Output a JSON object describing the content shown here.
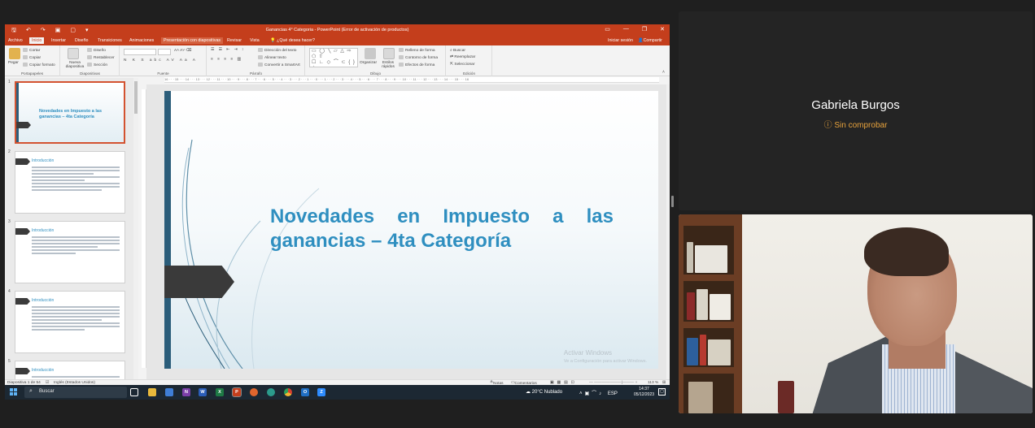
{
  "powerpoint": {
    "window_title": "Ganancias 4° Categoria - PowerPoint (Error de activación de productos)",
    "tabs": [
      "Archivo",
      "Inicio",
      "Insertar",
      "Diseño",
      "Transiciones",
      "Animaciones",
      "Presentación con diapositivas",
      "Revisar",
      "Vista"
    ],
    "active_tab": "Inicio",
    "tell_me": "¿Qué desea hacer?",
    "sign_in": "Iniciar sesión",
    "share": "Compartir",
    "ribbon": {
      "portapapeles": {
        "label": "Portapapeles",
        "pegar": "Pegar",
        "cortar": "Cortar",
        "copiar": "Copiar",
        "copiar_formato": "Copiar formato"
      },
      "diapositivas": {
        "label": "Diapositivas",
        "nueva": "Nueva diapositiva",
        "diseno": "Diseño",
        "restablecer": "Restablecer",
        "seccion": "Sección"
      },
      "fuente": {
        "label": "Fuente"
      },
      "parrafo": {
        "label": "Párrafo",
        "direccion": "Dirección del texto",
        "alinear": "Alinear texto",
        "smartart": "Convertir a SmartArt"
      },
      "dibujo": {
        "label": "Dibujo",
        "organizar": "Organizar",
        "estilos": "Estilos rápidos",
        "relleno": "Relleno de forma",
        "contorno": "Contorno de forma",
        "efectos": "Efectos de forma"
      },
      "edicion": {
        "label": "Edición",
        "buscar": "Buscar",
        "reemplazar": "Reemplazar",
        "seleccionar": "Seleccionar"
      }
    },
    "ruler_text": "16 · · · 15 · · · 14 · · · 13 · · · 12 · · · 11 · · · 10 · · · 9 · · · 8 · · · 7 · · · 6 · · · 5 · · · 4 · · · 3 · · · 2 · · · 1 · · · 0 · · · 1 · · · 2 · · · 3 · · · 4 · · · 5 · · · 6 · · · 7 · · · 8 · · · 9 · · · 10 · · · 11 · · · 12 · · · 13 · · · 14 · · · 15 · · · 16",
    "thumbnails": [
      {
        "num": "1",
        "heading": "",
        "title": "Novedades en Impuesto a las ganancias – 4ta Categoría"
      },
      {
        "num": "2",
        "heading": "Introducción",
        "title": ""
      },
      {
        "num": "3",
        "heading": "Introducción",
        "title": ""
      },
      {
        "num": "4",
        "heading": "Introducción",
        "title": ""
      },
      {
        "num": "5",
        "heading": "Introducción",
        "title": ""
      }
    ],
    "slide": {
      "title": "Novedades en Impuesto a las ganancias – 4ta Categoría",
      "watermark_1": "Activar Windows",
      "watermark_2": "Ve a Configuración para activar Windows."
    },
    "status": {
      "slide_count": "Diapositiva 1 de 54",
      "language": "Inglés (Estados Unidos)",
      "notes": "Notas",
      "comments": "Comentarios",
      "zoom": "113 %"
    }
  },
  "taskbar": {
    "search": "Buscar",
    "weather_temp": "20°C",
    "weather_desc": "Nublado",
    "lang": "ESP",
    "time": "14:37",
    "date": "05/12/2023",
    "apps": [
      "task-view",
      "file-explorer",
      "store",
      "onenote",
      "word",
      "excel",
      "powerpoint",
      "firefox",
      "edge",
      "chrome",
      "outlook",
      "zoom"
    ]
  },
  "participants": [
    {
      "name": "Gabriela Burgos",
      "status": "Sin comprobar",
      "status_color": "#e8a33d"
    },
    {
      "name": "",
      "video": true
    }
  ],
  "colors": {
    "powerpoint_accent": "#c43e1c",
    "slide_title": "#2f8fc0",
    "slide_bar": "#2b5d7a"
  }
}
